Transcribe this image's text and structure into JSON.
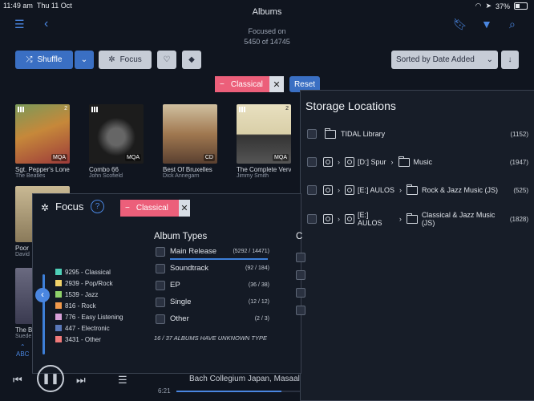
{
  "status": {
    "time": "11:49 am",
    "date": "Thu 11 Oct",
    "battery": "37%"
  },
  "header": {
    "title": "Albums",
    "focused_line1": "Focused on",
    "focused_line2": "5450 of 14745"
  },
  "toolbar": {
    "shuffle": "Shuffle",
    "focus": "Focus",
    "sort": "Sorted by Date Added",
    "filter_chip": "Classical",
    "reset": "Reset"
  },
  "albums_row1": [
    {
      "title": "Sgt. Pepper's Lonely",
      "artist": "The Beatles",
      "badge": "2",
      "fmt": "MQA",
      "color": "#c6883a"
    },
    {
      "title": "Combo 66",
      "artist": "John Scofield",
      "badge": "",
      "fmt": "MQA",
      "color": "#1c1c1c"
    },
    {
      "title": "Best Of Bruxelles",
      "artist": "Dick Annegarn",
      "badge": "",
      "fmt": "CD",
      "color": "#a07850"
    },
    {
      "title": "The Complete Verve",
      "artist": "Jimmy Smith",
      "badge": "2",
      "fmt": "MQA",
      "color": "#d9cfa8"
    }
  ],
  "albums_row2": [
    {
      "title": "Poor",
      "artist": "David"
    },
    {
      "title": "The B",
      "artist": "Suede"
    }
  ],
  "abc_label": "ABC",
  "storage": {
    "title": "Storage Locations",
    "rows": [
      {
        "path": [
          "TIDAL Library"
        ],
        "count": "(1152)"
      },
      {
        "path": [
          "[D:] Spur",
          "Music"
        ],
        "count": "(1947)"
      },
      {
        "path": [
          "[E:] AULOS",
          "Rock & Jazz Music (JS)"
        ],
        "count": "(525)"
      },
      {
        "path": [
          "[E:] AULOS",
          "Classical & Jazz Music (JS)"
        ],
        "count": "(1828)"
      }
    ]
  },
  "focus": {
    "title": "Focus",
    "help": "?",
    "chip": "Classical",
    "legend": [
      {
        "label": "9295 - Classical",
        "color": "#4fd0b8"
      },
      {
        "label": "2939 - Pop/Rock",
        "color": "#f1d26a"
      },
      {
        "label": "1539 - Jazz",
        "color": "#8fd16a"
      },
      {
        "label": "816 - Rock",
        "color": "#f29a4c"
      },
      {
        "label": "776 - Easy Listening",
        "color": "#d8a0d8"
      },
      {
        "label": "447 - Electronic",
        "color": "#5a78b8"
      },
      {
        "label": "3431 - Other",
        "color": "#f07a7a"
      }
    ],
    "types_header": "Album Types",
    "types_col2_header": "C",
    "types": [
      {
        "label": "Main Release",
        "count": "(5292 / 14471)"
      },
      {
        "label": "Soundtrack",
        "count": "(92 / 184)"
      },
      {
        "label": "EP",
        "count": "(36 / 38)"
      },
      {
        "label": "Single",
        "count": "(12 / 12)"
      },
      {
        "label": "Other",
        "count": "(2 / 3)"
      }
    ],
    "unknown_note": "16 / 37 ALBUMS HAVE UNKNOWN TYPE"
  },
  "player": {
    "now_playing": "Bach Collegium Japan, Masaal",
    "time": "6:21",
    "progress_percent": 85
  }
}
